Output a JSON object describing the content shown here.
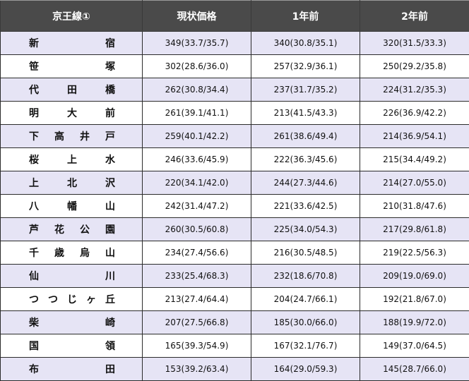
{
  "table": {
    "headers": [
      "京王線①",
      "現状価格",
      "1年前",
      "2年前"
    ],
    "rows": [
      {
        "station": "新宿",
        "current": "349(33.7/35.7)",
        "year1": "340(30.8/35.1)",
        "year2": "320(31.5/33.3)"
      },
      {
        "station": "笹塚",
        "current": "302(28.6/36.0)",
        "year1": "257(32.9/36.1)",
        "year2": "250(29.2/35.8)"
      },
      {
        "station": "代田橋",
        "current": "262(30.8/34.4)",
        "year1": "237(31.7/35.2)",
        "year2": "224(31.2/35.3)"
      },
      {
        "station": "明大前",
        "current": "261(39.1/41.1)",
        "year1": "213(41.5/43.3)",
        "year2": "226(36.9/42.2)"
      },
      {
        "station": "下高井戸",
        "current": "259(40.1/42.2)",
        "year1": "261(38.6/49.4)",
        "year2": "214(36.9/54.1)"
      },
      {
        "station": "桜上水",
        "current": "246(33.6/45.9)",
        "year1": "222(36.3/45.6)",
        "year2": "215(34.4/49.2)"
      },
      {
        "station": "上北沢",
        "current": "220(34.1/42.0)",
        "year1": "244(27.3/44.6)",
        "year2": "214(27.0/55.0)"
      },
      {
        "station": "八幡山",
        "current": "242(31.4/47.2)",
        "year1": "221(33.6/42.5)",
        "year2": "210(31.8/47.6)"
      },
      {
        "station": "芦花公園",
        "current": "260(30.5/60.8)",
        "year1": "225(34.0/54.3)",
        "year2": "217(29.8/61.8)"
      },
      {
        "station": "千歳烏山",
        "current": "234(27.4/56.6)",
        "year1": "216(30.5/48.5)",
        "year2": "219(22.5/56.3)"
      },
      {
        "station": "仙川",
        "current": "233(25.4/68.3)",
        "year1": "232(18.6/70.8)",
        "year2": "209(19.0/69.0)"
      },
      {
        "station": "つつじヶ丘",
        "current": "213(27.4/64.4)",
        "year1": "204(24.7/66.1)",
        "year2": "192(21.8/67.0)"
      },
      {
        "station": "柴崎",
        "current": "207(27.5/66.8)",
        "year1": "185(30.0/66.0)",
        "year2": "188(19.9/72.0)"
      },
      {
        "station": "国領",
        "current": "165(39.3/54.9)",
        "year1": "167(32.1/76.7)",
        "year2": "149(37.0/64.5)"
      },
      {
        "station": "布田",
        "current": "153(39.2/63.4)",
        "year1": "164(29.0/59.3)",
        "year2": "145(28.7/66.0)"
      }
    ]
  }
}
